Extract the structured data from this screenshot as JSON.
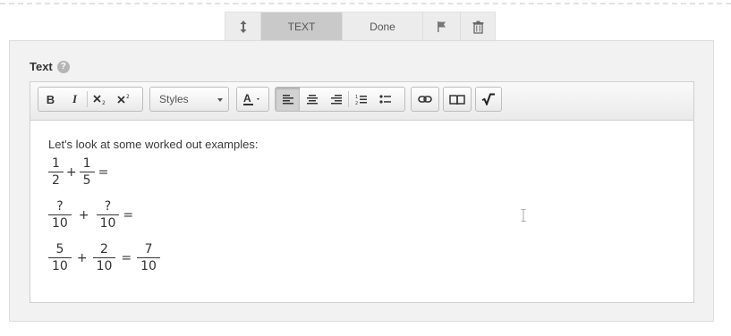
{
  "action_bar": {
    "move_icon": "vertical-arrows-icon",
    "text_label": "TEXT",
    "done_label": "Done",
    "flag_icon": "flag-icon",
    "trash_icon": "trash-icon"
  },
  "field": {
    "label": "Text",
    "help": "?"
  },
  "toolbar": {
    "bold": "B",
    "italic": "I",
    "subscript_icon": "subscript-icon",
    "superscript_icon": "superscript-icon",
    "styles_value": "Styles",
    "font_color_icon": "font-color-icon",
    "align_left_icon": "align-left-icon",
    "align_center_icon": "align-center-icon",
    "align_right_icon": "align-right-icon",
    "ordered_list_icon": "ordered-list-icon",
    "unordered_list_icon": "unordered-list-icon",
    "link_icon": "link-icon",
    "book_icon": "book-icon",
    "sqrt_icon": "square-root-icon"
  },
  "content": {
    "intro": "Let's look at some worked out examples:",
    "eq1": {
      "a_num": "1",
      "a_den": "2",
      "op": "+",
      "b_num": "1",
      "b_den": "5",
      "eq": "="
    },
    "eq2": {
      "a_num": "?",
      "a_den": "10",
      "op": "+",
      "b_num": "?",
      "b_den": "10",
      "eq": "="
    },
    "eq3": {
      "a_num": "5",
      "a_den": "10",
      "op": "+",
      "b_num": "2",
      "b_den": "10",
      "eq": "=",
      "c_num": "7",
      "c_den": "10"
    }
  }
}
